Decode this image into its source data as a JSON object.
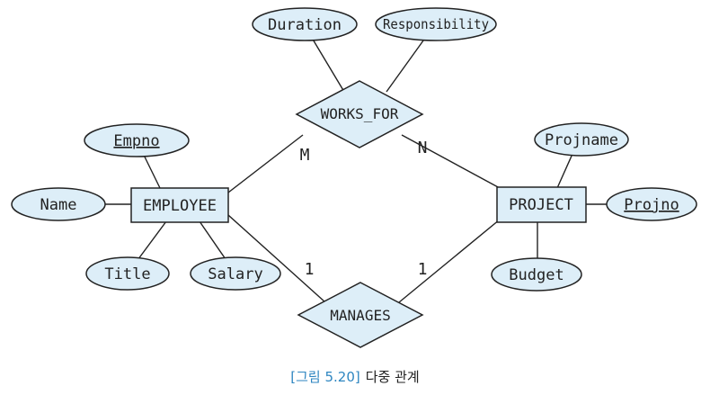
{
  "diagram": {
    "entities": {
      "employee": "EMPLOYEE",
      "project": "PROJECT"
    },
    "relationships": {
      "works_for": "WORKS_FOR",
      "manages": "MANAGES"
    },
    "attributes": {
      "duration": "Duration",
      "responsibility": "Responsibility",
      "empno": "Empno",
      "name": "Name",
      "title": "Title",
      "salary": "Salary",
      "projname": "Projname",
      "projno": "Projno",
      "budget": "Budget"
    },
    "cardinalities": {
      "works_for_employee": "M",
      "works_for_project": "N",
      "manages_employee": "1",
      "manages_project": "1"
    },
    "colors": {
      "fill": "#ddeef8",
      "stroke": "#222222",
      "caption_accent": "#2e86c1"
    }
  },
  "caption": {
    "figure_label": "[그림 5.20]",
    "text": "다중 관계"
  }
}
